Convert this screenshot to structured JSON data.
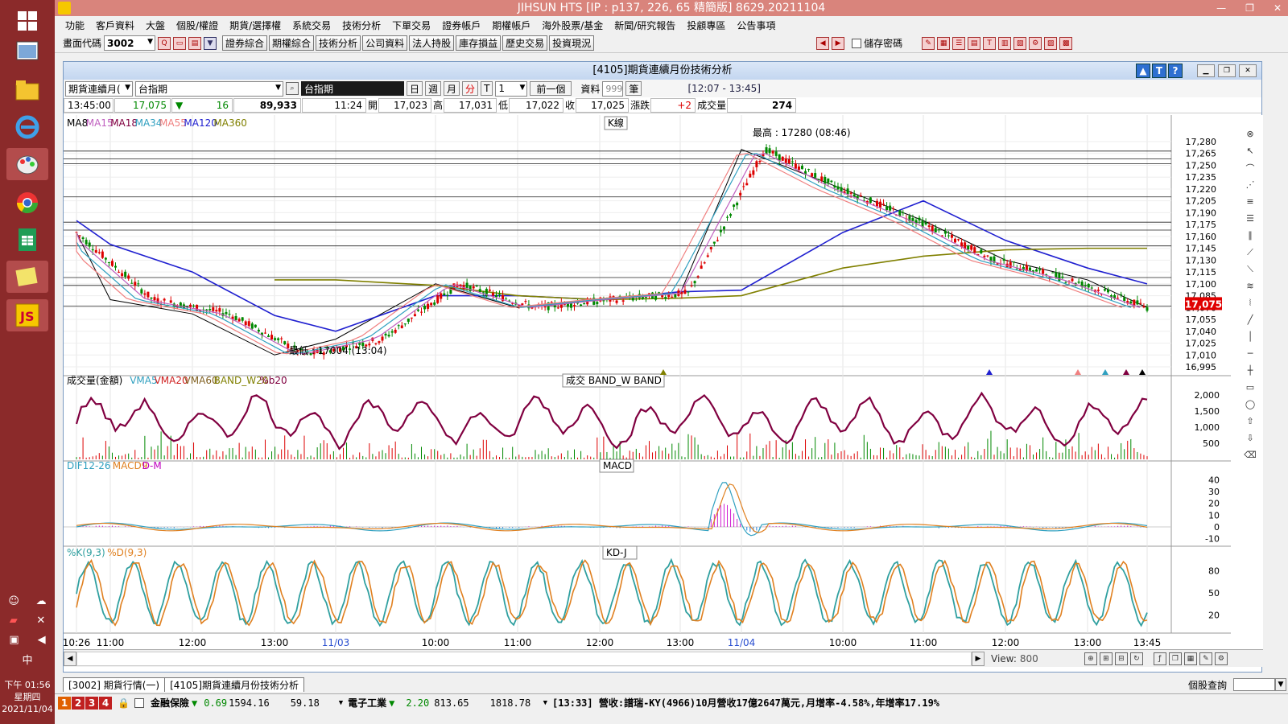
{
  "window": {
    "title": "JIHSUN HTS      [IP : p137, 226, 65 精簡版] 8629.20211104",
    "controls": [
      "—",
      "❐",
      "✕"
    ]
  },
  "menu": [
    "功能",
    "客戶資料",
    "大盤",
    "個股/權證",
    "期貨/選擇權",
    "系統交易",
    "技術分析",
    "下單交易",
    "證券帳戶",
    "期權帳戶",
    "海外股票/基金",
    "新聞/研究報告",
    "投顧專區",
    "公告事項"
  ],
  "toolbar": {
    "code_label": "畫面代碼",
    "code_value": "3002",
    "buttons": [
      "證券綜合",
      "期權綜合",
      "技術分析",
      "公司資料",
      "法人持股",
      "庫存損益",
      "歷史交易",
      "投資現況"
    ],
    "save_password_label": "儲存密碼"
  },
  "child": {
    "title": "[4105]期貨連續月份技術分析",
    "help_buttons": [
      "▲",
      "T",
      "?"
    ]
  },
  "chartbar": {
    "type_select": "期貨連續月(",
    "symbol": "台指期",
    "symbol_dark": "台指期",
    "periods": [
      "日",
      "週",
      "月",
      "分"
    ],
    "t_btn": "T",
    "interval": "1",
    "prev": "前一個",
    "data_label": "資料",
    "data_count": "999",
    "data_unit": "筆",
    "time_range": "[12:07 - 13:45]"
  },
  "quote": {
    "time": "13:45:00",
    "price": "17,075",
    "change": "16",
    "volume": "89,933",
    "cursor_time": "11:24",
    "open_label": "開",
    "open": "17,023",
    "high_label": "高",
    "high": "17,031",
    "low_label": "低",
    "low": "17,022",
    "close_label": "收",
    "close": "17,025",
    "chg_label": "漲跌",
    "chg": "+2",
    "vol_label": "成交量",
    "vol": "274"
  },
  "panes": {
    "kline": {
      "title": "K線",
      "legend": [
        {
          "t": "MA8",
          "c": "#000000"
        },
        {
          "t": "MA15",
          "c": "#c060c0"
        },
        {
          "t": "MA18",
          "c": "#800040"
        },
        {
          "t": "MA34",
          "c": "#30a0c0"
        },
        {
          "t": "MA55",
          "c": "#f08080"
        },
        {
          "t": "MA120",
          "c": "#2020d0"
        },
        {
          "t": "MA360",
          "c": "#808000"
        }
      ],
      "high_label": "最高 : 17280 (08:46)",
      "low_label": "最低 : 17004 (13:04)",
      "price_tag": "17,075"
    },
    "volume": {
      "title": "成交  BAND_W  BAND",
      "legend": [
        {
          "t": "成交量(金額)",
          "c": "#000000"
        },
        {
          "t": "VMA5",
          "c": "#30a0c0"
        },
        {
          "t": "VMA20",
          "c": "#d02020"
        },
        {
          "t": "VMA60",
          "c": "#806020"
        },
        {
          "t": "BAND_W20",
          "c": "#808000"
        },
        {
          "t": "%b20",
          "c": "#800040"
        }
      ]
    },
    "macd": {
      "title": "MACD",
      "legend": [
        {
          "t": "DIF12-26",
          "c": "#30a0c0"
        },
        {
          "t": "MACD9",
          "c": "#e08020"
        },
        {
          "t": "D-M",
          "c": "#c000c0"
        }
      ]
    },
    "kd": {
      "title": "KD-J",
      "legend": [
        {
          "t": "%K(9,3)",
          "c": "#30a0a0"
        },
        {
          "t": "%D(9,3)",
          "c": "#e08020"
        }
      ]
    }
  },
  "axes": {
    "price_ticks": [
      "17,280",
      "17,265",
      "17,250",
      "17,235",
      "17,220",
      "17,205",
      "17,190",
      "17,175",
      "17,160",
      "17,145",
      "17,130",
      "17,115",
      "17,100",
      "17,085",
      "17,070",
      "17,055",
      "17,040",
      "17,025",
      "17,010",
      "16,995"
    ],
    "volume_ticks": [
      "2,000",
      "1,500",
      "1,000",
      "500"
    ],
    "macd_ticks": [
      "40",
      "30",
      "20",
      "10",
      "0",
      "-10"
    ],
    "kd_ticks": [
      "80",
      "50",
      "20"
    ],
    "time_labels": [
      {
        "t": "10:26",
        "c": "#000000"
      },
      {
        "t": "11:00",
        "c": "#000000"
      },
      {
        "t": "12:00",
        "c": "#000000"
      },
      {
        "t": "13:00",
        "c": "#000000"
      },
      {
        "t": "11/03",
        "c": "#2a4fd0"
      },
      {
        "t": "10:00",
        "c": "#000000"
      },
      {
        "t": "11:00",
        "c": "#000000"
      },
      {
        "t": "12:00",
        "c": "#000000"
      },
      {
        "t": "13:00",
        "c": "#000000"
      },
      {
        "t": "11/04",
        "c": "#2a4fd0"
      },
      {
        "t": "10:00",
        "c": "#000000"
      },
      {
        "t": "11:00",
        "c": "#000000"
      },
      {
        "t": "12:00",
        "c": "#000000"
      },
      {
        "t": "13:00",
        "c": "#000000"
      },
      {
        "t": "13:45",
        "c": "#000000"
      }
    ]
  },
  "scrollbar": {
    "view_label": "View:",
    "view_value": "800"
  },
  "tabs": [
    "[3002] 期貨行情(一)",
    "[4105]期貨連續月份技術分析"
  ],
  "bottom_right": "個股查詢",
  "status": {
    "nums": [
      "1",
      "2",
      "3",
      "4"
    ],
    "sector1": "金融保險",
    "s1_chg": "0.69",
    "s1_idx": "1594.16",
    "s1_val": "59.18",
    "sector2": "電子工業",
    "s2_chg": "2.20",
    "s2_idx": "813.65",
    "s2_val": "1818.78",
    "ticker": "[13:33] 營收:譜瑞-KY(4966)10月營收17億2647萬元,月增率-4.58%,年增率17.19%"
  },
  "clock": {
    "time": "下午 01:56",
    "day": "星期四",
    "date": "2021/11/04",
    "ime": "中"
  },
  "chart_data": {
    "type": "line",
    "title": "K線",
    "price_range": [
      16995,
      17280
    ],
    "high": 17280,
    "low": 17004,
    "last": 17075,
    "x": [
      "10:26",
      "11:00",
      "12:00",
      "13:00",
      "11/03",
      "10:00",
      "11:00",
      "12:00",
      "13:00",
      "11/04",
      "10:00",
      "11:00",
      "12:00",
      "13:00",
      "13:45"
    ],
    "series": [
      {
        "name": "MA8",
        "values": [
          17165,
          17080,
          17062,
          17010,
          17030,
          17100,
          17070,
          17080,
          17088,
          17270,
          17220,
          17180,
          17130,
          17105,
          17070
        ]
      },
      {
        "name": "MA120",
        "values": [
          17180,
          17150,
          17115,
          17060,
          17040,
          17085,
          17085,
          17080,
          17090,
          17092,
          17165,
          17205,
          17155,
          17120,
          17100
        ]
      },
      {
        "name": "MA360",
        "values": [
          null,
          null,
          null,
          17105,
          17105,
          17098,
          17085,
          17080,
          17082,
          17085,
          17120,
          17135,
          17143,
          17145,
          17145
        ]
      }
    ],
    "macd_range": [
      -15,
      45
    ],
    "kd_range": [
      0,
      100
    ],
    "volume_range": [
      0,
      2200
    ]
  }
}
